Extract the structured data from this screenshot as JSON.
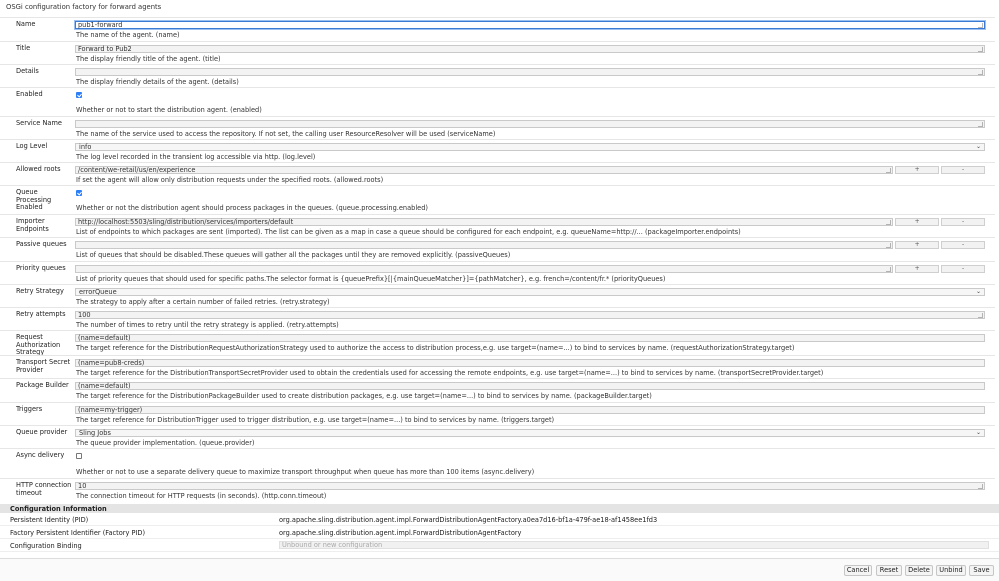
{
  "page": {
    "title": "OSGi configuration factory for forward agents"
  },
  "fields": {
    "name": {
      "label": "Name",
      "value": "pub1-forward",
      "desc": "The name of the agent. (name)"
    },
    "title": {
      "label": "Title",
      "value": "Forward to Pub2",
      "desc": "The display friendly title of the agent. (title)"
    },
    "details": {
      "label": "Details",
      "value": "",
      "desc": "The display friendly details of the agent. (details)"
    },
    "enabled": {
      "label": "Enabled",
      "checked": true,
      "desc": "Whether or not to start the distribution agent. (enabled)"
    },
    "service_name": {
      "label": "Service Name",
      "value": "",
      "desc": "The name of the service used to access the repository. If not set, the calling user ResourceResolver will be used (serviceName)"
    },
    "log_level": {
      "label": "Log Level",
      "value": "info",
      "desc": "The log level recorded in the transient log accessible via http. (log.level)"
    },
    "allowed_roots": {
      "label": "Allowed roots",
      "value": "/content/we-retail/us/en/experience",
      "plus": "+",
      "minus": "-",
      "desc": "If set the agent will allow only distribution requests under the specified roots. (allowed.roots)"
    },
    "queue_processing": {
      "label": "Queue Processing Enabled",
      "checked": true,
      "desc": "Whether or not the distribution agent should process packages in the queues. (queue.processing.enabled)"
    },
    "importer_endpoints": {
      "label": "Importer Endpoints",
      "value": "http://localhost:5503/sling/distribution/services/importers/default",
      "plus": "+",
      "minus": "-",
      "desc": "List of endpoints to which packages are sent (imported). The list can be given as a map in case a queue should be configured for each endpoint, e.g. queueName=http://... (packageImporter.endpoints)"
    },
    "passive_queues": {
      "label": "Passive queues",
      "value": "",
      "plus": "+",
      "minus": "-",
      "desc": "List of queues that should be disabled.These queues will gather all the packages until they are removed explicitly. (passiveQueues)"
    },
    "priority_queues": {
      "label": "Priority queues",
      "value": "",
      "plus": "+",
      "minus": "-",
      "desc": "List of priority queues that should used for specific paths.The selector format is {queuePrefix}[|{mainQueueMatcher}]={pathMatcher}, e.g. french=/content/fr.* (priorityQueues)"
    },
    "retry_strategy": {
      "label": "Retry Strategy",
      "value": "errorQueue",
      "desc": "The strategy to apply after a certain number of failed retries. (retry.strategy)"
    },
    "retry_attempts": {
      "label": "Retry attempts",
      "value": "100",
      "desc": "The number of times to retry until the retry strategy is applied. (retry.attempts)"
    },
    "request_auth": {
      "label": "Request Authorization Strategy",
      "value": "(name=default)",
      "desc": "The target reference for the DistributionRequestAuthorizationStrategy used to authorize the access to distribution process,e.g. use target=(name=...) to bind to services by name. (requestAuthorizationStrategy.target)"
    },
    "transport_secret": {
      "label": "Transport Secret Provider",
      "value": "(name=pub8-creds)",
      "desc": "The target reference for the DistributionTransportSecretProvider used to obtain the credentials used for accessing the remote endpoints, e.g. use target=(name=...) to bind to services by name. (transportSecretProvider.target)"
    },
    "package_builder": {
      "label": "Package Builder",
      "value": "(name=default)",
      "desc": "The target reference for the DistributionPackageBuilder used to create distribution packages, e.g. use target=(name=...) to bind to services by name. (packageBuilder.target)"
    },
    "triggers": {
      "label": "Triggers",
      "value": "(name=my-trigger)",
      "desc": "The target reference for DistributionTrigger used to trigger distribution, e.g. use target=(name=...) to bind to services by name. (triggers.target)"
    },
    "queue_provider": {
      "label": "Queue provider",
      "value": "Sling Jobs",
      "desc": "The queue provider implementation. (queue.provider)"
    },
    "async_delivery": {
      "label": "Async delivery",
      "checked": false,
      "desc": "Whether or not to use a separate delivery queue to maximize transport throughput when queue has more than 100 items (async.delivery)"
    },
    "http_timeout": {
      "label": "HTTP connection timeout",
      "value": "10",
      "desc": "The connection timeout for HTTP requests (in seconds). (http.conn.timeout)"
    }
  },
  "config_info": {
    "heading": "Configuration Information",
    "pid_label": "Persistent Identity (PID)",
    "pid_value": "org.apache.sling.distribution.agent.impl.ForwardDistributionAgentFactory.a0ea7d16-bf1a-479f-ae18-af1458ee1fd3",
    "factory_label": "Factory Persistent Identifier (Factory PID)",
    "factory_value": "org.apache.sling.distribution.agent.impl.ForwardDistributionAgentFactory",
    "binding_label": "Configuration Binding",
    "binding_placeholder": "Unbound or new configuration"
  },
  "buttons": {
    "cancel": "Cancel",
    "reset": "Reset",
    "delete": "Delete",
    "unbind": "Unbind",
    "save": "Save"
  },
  "icons": {
    "select": "chevron-down-icon",
    "resize": "resize-grip-icon",
    "checkbox": "checkbox-icon"
  },
  "colors": {
    "accent": "#2d7ff9",
    "focus": "#3b7bd4",
    "section_bg": "#e4e4e4"
  }
}
